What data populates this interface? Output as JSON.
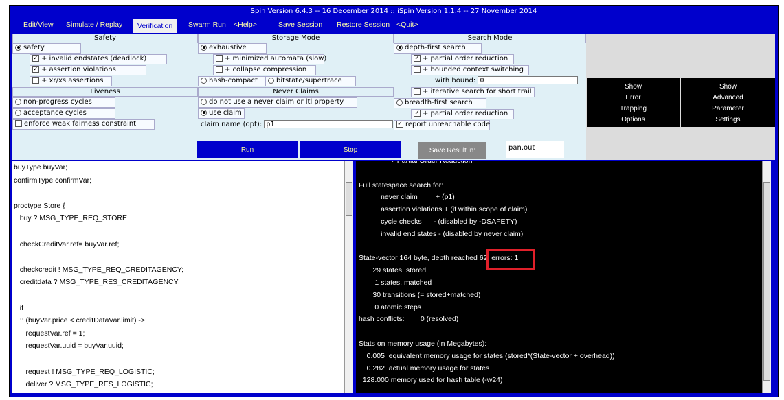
{
  "window": {
    "title": "Spin Version 6.4.3 -- 16 December 2014 :: iSpin Version 1.1.4 -- 27 November 2014"
  },
  "menu": {
    "items": [
      "Edit/View",
      "Simulate / Replay",
      "Verification",
      "Swarm Run",
      "<Help>",
      "Save Session",
      "Restore Session",
      "<Quit>"
    ],
    "active": "Verification"
  },
  "safety": {
    "header": "Safety",
    "safety_label": "safety",
    "invalid_endstates": "+ invalid endstates (deadlock)",
    "assertion_violations": "+ assertion violations",
    "xr_xs": "+ xr/xs assertions"
  },
  "liveness": {
    "header": "Liveness",
    "non_progress": "non-progress cycles",
    "acceptance": "acceptance cycles",
    "weak_fairness": "enforce weak fairness constraint"
  },
  "storage": {
    "header": "Storage Mode",
    "exhaustive": "exhaustive",
    "minimized": "+ minimized automata (slow)",
    "collapse": "+ collapse compression",
    "hash_compact": "hash-compact",
    "bitstate": "bitstate/supertrace"
  },
  "never_claims": {
    "header": "Never Claims",
    "do_not_use": "do not use a never claim or ltl property",
    "use_claim": "use claim",
    "claim_name_label": "claim name (opt):",
    "claim_name_value": "p1"
  },
  "search": {
    "header": "Search Mode",
    "dfs": "depth-first search",
    "partial_order": "+ partial order reduction",
    "bounded": "+ bounded context switching",
    "bound_label": "with bound:",
    "bound_value": "0",
    "iterative": "+ iterative search for short trail",
    "bfs": "breadth-first search",
    "partial_order_bfs": "+ partial order reduction",
    "unreachable": "report unreachable code"
  },
  "buttons": {
    "run": "Run",
    "stop": "Stop",
    "save_result": "Save Result in:",
    "outfile": "pan.out",
    "error_trapping": [
      "Show",
      "Error",
      "Trapping",
      "Options"
    ],
    "advanced": [
      "Show",
      "Advanced",
      "Parameter",
      "Settings"
    ]
  },
  "editor_lines": [
    "buyType buyVar;",
    "confirmType confirmVar;",
    "",
    "proctype Store {",
    "   buy ? MSG_TYPE_REQ_STORE;",
    "",
    "   checkCreditVar.ref= buyVar.ref;",
    "",
    "   checkcredit ! MSG_TYPE_REQ_CREDITAGENCY;",
    "   creditdata ? MSG_TYPE_RES_CREDITAGENCY;",
    "",
    "   if",
    "   :: (buyVar.price < creditDataVar.limit) ->;",
    "      requestVar.ref = 1;",
    "      requestVar.uuid = buyVar.uuid;",
    "",
    "      request ! MSG_TYPE_REQ_LOGISTIC;",
    "      deliver ? MSG_TYPE_RES_LOGISTIC;"
  ],
  "console_lines": [
    "                + Partial Order Reduction",
    "",
    "Full statespace search for:",
    "           never claim         + (p1)",
    "           assertion violations + (if within scope of claim)",
    "           cycle checks      - (disabled by -DSAFETY)",
    "           invalid end states - (disabled by never claim)",
    "",
    "State-vector 164 byte, depth reached 62, errors: 1",
    "       29 states, stored",
    "        1 states, matched",
    "       30 transitions (= stored+matched)",
    "        0 atomic steps",
    "hash conflicts:        0 (resolved)",
    "",
    "Stats on memory usage (in Megabytes):",
    "    0.005  equivalent memory usage for states (stored*(State-vector + overhead))",
    "    0.282  actual memory usage for states",
    "  128.000 memory used for hash table (-w24)"
  ]
}
